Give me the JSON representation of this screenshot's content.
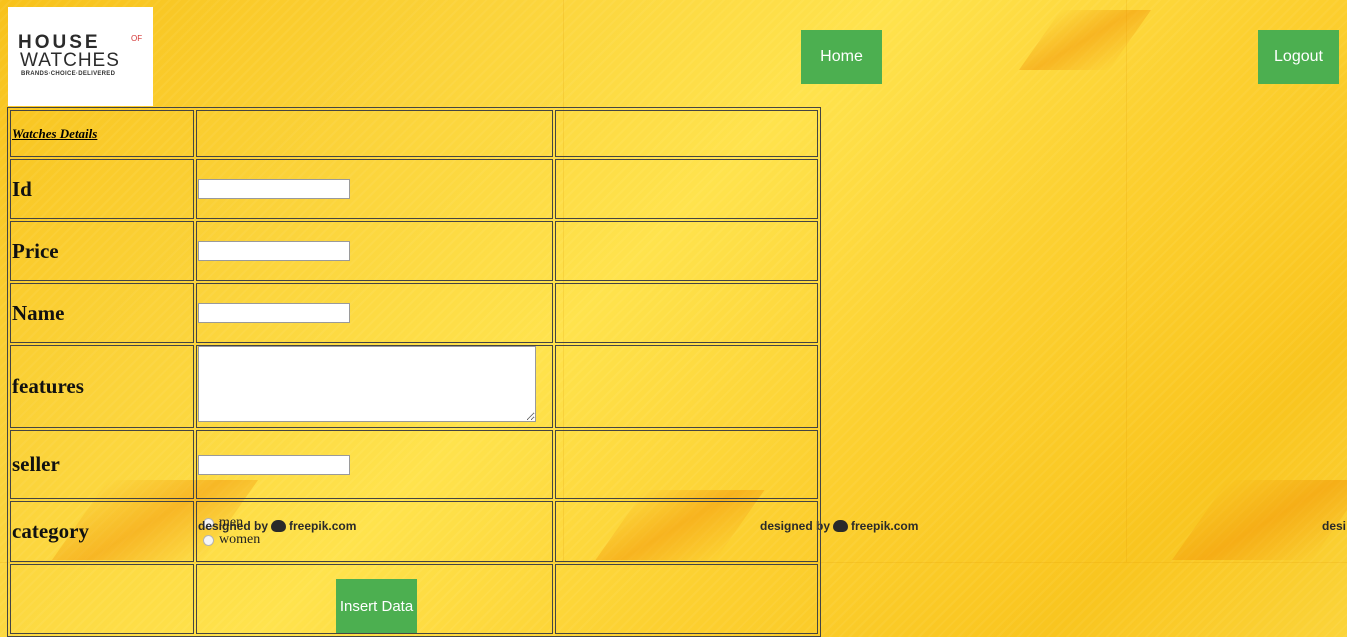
{
  "logo": {
    "line1": "HOUSE",
    "of": "OF",
    "line2": "WATCHES",
    "tagline": "BRANDS·CHOICE·DELIVERED"
  },
  "nav": {
    "home": "Home",
    "logout": "Logout"
  },
  "form": {
    "title": "Watches Details",
    "fields": {
      "id": {
        "label": "Id",
        "value": ""
      },
      "price": {
        "label": "Price",
        "value": ""
      },
      "name": {
        "label": "Name",
        "value": ""
      },
      "features": {
        "label": "features",
        "value": ""
      },
      "seller": {
        "label": "seller",
        "value": ""
      },
      "category": {
        "label": "category",
        "options": [
          "men",
          "women"
        ]
      }
    },
    "submit": "Insert Data"
  },
  "watermark": {
    "prefix": "designed by",
    "brand": "freepik.com",
    "partial": "desi"
  },
  "colors": {
    "accent": "#4caf50",
    "background": "#fbd33a"
  }
}
